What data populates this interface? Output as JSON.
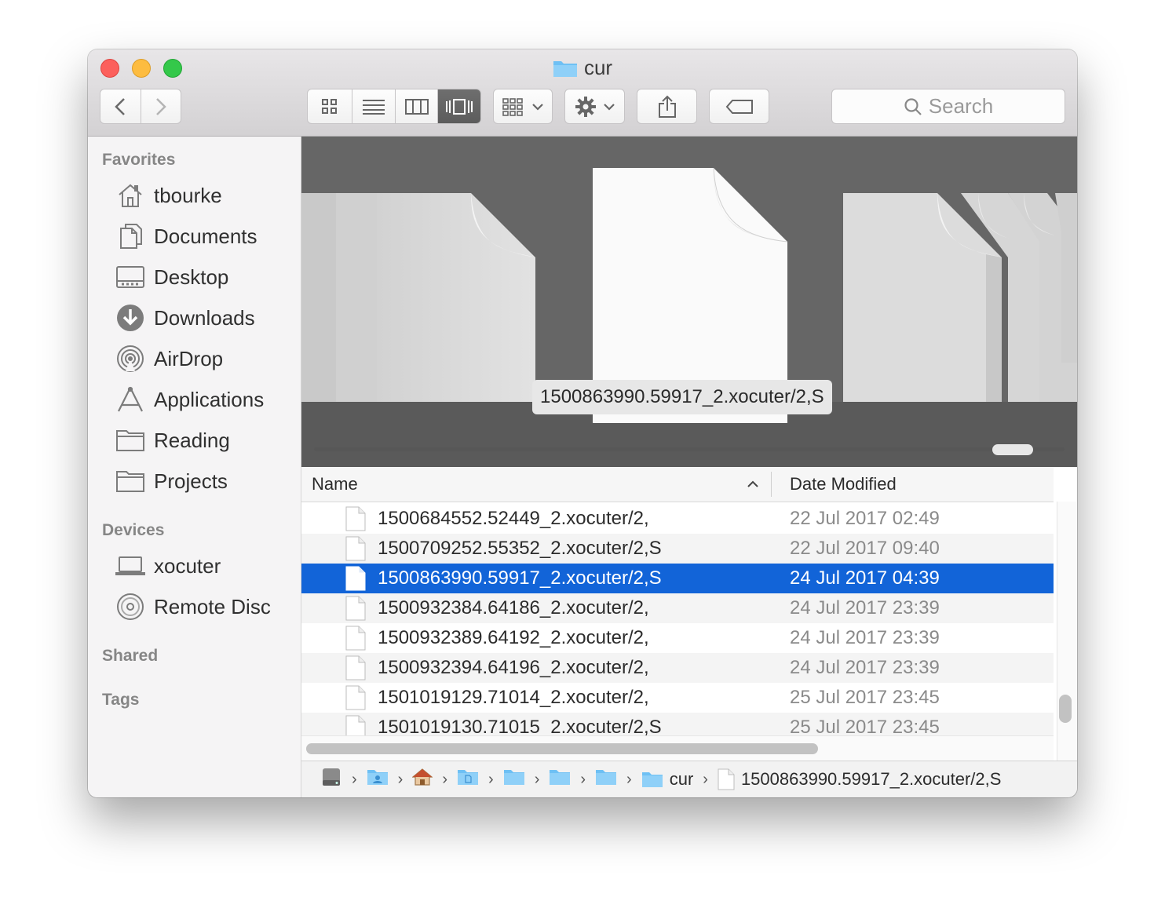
{
  "window": {
    "title": "cur"
  },
  "search": {
    "placeholder": "Search"
  },
  "sidebar": {
    "favorites_header": "Favorites",
    "favorites": [
      {
        "label": "tbourke",
        "icon": "home-icon"
      },
      {
        "label": "Documents",
        "icon": "documents-icon"
      },
      {
        "label": "Desktop",
        "icon": "desktop-icon"
      },
      {
        "label": "Downloads",
        "icon": "downloads-icon"
      },
      {
        "label": "AirDrop",
        "icon": "airdrop-icon"
      },
      {
        "label": "Applications",
        "icon": "applications-icon"
      },
      {
        "label": "Reading",
        "icon": "folder-icon"
      },
      {
        "label": "Projects",
        "icon": "folder-icon"
      }
    ],
    "devices_header": "Devices",
    "devices": [
      {
        "label": "xocuter",
        "icon": "laptop-icon"
      },
      {
        "label": "Remote Disc",
        "icon": "disc-icon"
      }
    ],
    "shared_header": "Shared",
    "tags_header": "Tags"
  },
  "cover_flow": {
    "selected_label": "1500863990.59917_2.xocuter/2,S",
    "scroll_position": 0.92
  },
  "list": {
    "columns": {
      "name": "Name",
      "date": "Date Modified"
    },
    "sort": "name-ascending",
    "rows": [
      {
        "name": "1500684552.52449_2.xocuter/2,",
        "date": "22 Jul 2017 02:49"
      },
      {
        "name": "1500709252.55352_2.xocuter/2,S",
        "date": "22 Jul 2017 09:40"
      },
      {
        "name": "1500863990.59917_2.xocuter/2,S",
        "date": "24 Jul 2017 04:39",
        "selected": true
      },
      {
        "name": "1500932384.64186_2.xocuter/2,",
        "date": "24 Jul 2017 23:39"
      },
      {
        "name": "1500932389.64192_2.xocuter/2,",
        "date": "24 Jul 2017 23:39"
      },
      {
        "name": "1500932394.64196_2.xocuter/2,",
        "date": "24 Jul 2017 23:39"
      },
      {
        "name": "1501019129.71014_2.xocuter/2,",
        "date": "25 Jul 2017 23:45"
      },
      {
        "name": "1501019130.71015_2.xocuter/2,S",
        "date": "25 Jul 2017 23:45"
      }
    ]
  },
  "pathbar": {
    "folder_label": "cur",
    "file_label": "1500863990.59917_2.xocuter/2,S"
  },
  "colors": {
    "selection": "#1264d8",
    "folder": "#5ab4f0"
  }
}
